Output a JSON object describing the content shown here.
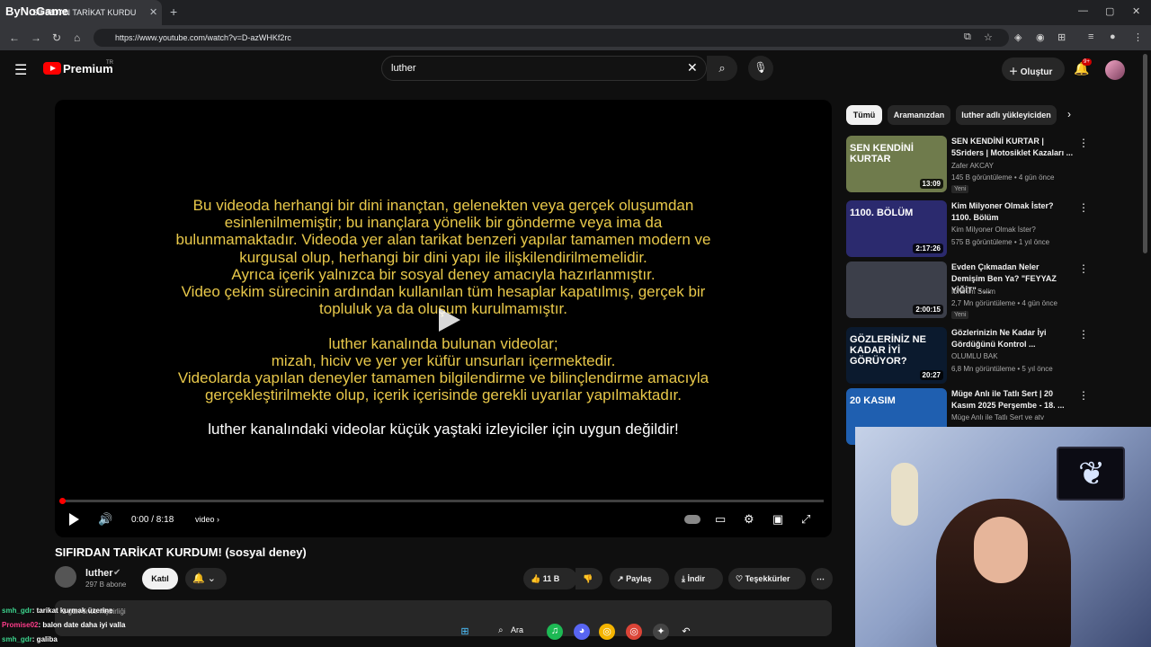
{
  "browser": {
    "tab_title": "SIFIRDAN TARİKAT KURDU",
    "tab_overlay_logo": "ByNoGame",
    "url": "https://www.youtube.com/watch?v=D-azWHKf2rc"
  },
  "youtube_header": {
    "logo_text": "Premium",
    "country": "TR",
    "search_value": "luther",
    "create_label": "Oluştur",
    "notification_count": "9+"
  },
  "player": {
    "disclaimer_lines": [
      "Bu videoda herhangi bir dini inançtan, gelenekten veya gerçek oluşumdan",
      "esinlenilmemiştir; bu inançlara yönelik bir gönderme veya ima da",
      "bulunmamaktadır. Videoda yer alan tarikat benzeri yapılar tamamen modern ve",
      "kurgusal olup, herhangi bir dini yapı ile ilişkilendirilmemelidir.",
      "Ayrıca içerik yalnızca bir sosyal deney amacıyla hazırlanmıştır.",
      "Video çekim sürecinin ardından kullanılan tüm hesaplar kapatılmış, gerçek bir",
      "topluluk ya da oluşum kurulmamıştır.",
      "",
      "luther kanalında bulunan videolar;",
      "mizah, hiciv ve yer yer küfür unsurları içermektedir.",
      "Videolarda yapılan deneyler tamamen bilgilendirme ve bilinçlendirme amacıyla",
      "gerçekleştirilmekte olup, içerik içerisinde gerekli uyarılar yapılmaktadır."
    ],
    "warning_line": "luther kanalındaki videolar küçük yaştaki izleyiciler için uygun değildir!",
    "time": "0:00 / 8:18",
    "chapter": "video",
    "progress_fraction": 0.0
  },
  "video": {
    "title": "SIFIRDAN TARİKAT KURDUM! (sosyal deney)",
    "channel_name": "luther",
    "subscribers": "297 B abone",
    "join_label": "Katıl",
    "likes": "11 B",
    "share_label": "Paylaş",
    "download_label": "İndir",
    "thanks_label": "Teşekkürler",
    "description_meta": "1 gün önce  #işbirliği"
  },
  "sidebar": {
    "chips": [
      "Tümü",
      "Aramanızdan",
      "luther adlı yükleyiciden"
    ],
    "videos": [
      {
        "title": "SEN KENDİNİ KURTAR | 5Sriders | Motosiklet Kazaları ...",
        "channel": "Zafer AKCAY",
        "meta": "145 B görüntüleme • 4 gün önce",
        "badge": "Yeni",
        "duration": "13:09",
        "thumb_text": "SEN KENDİNİ KURTAR",
        "thumb_color": "#6f7b4c"
      },
      {
        "title": "Kim Milyoner Olmak İster? 1100. Bölüm",
        "channel": "Kim Milyoner Olmak İster?",
        "meta": "575 B görüntüleme • 1 yıl önce",
        "badge": "",
        "duration": "2:17:26",
        "thumb_text": "1100. BÖLÜM",
        "thumb_color": "#2b2a6e"
      },
      {
        "title": "Evden Çıkmadan Neler Demişim Ben Ya? \"FEYYAZ YİĞİT\" - ...",
        "channel": "İbrahim Selim",
        "meta": "2,7 Mn görüntüleme • 4 gün önce",
        "badge": "Yeni",
        "duration": "2:00:15",
        "thumb_text": "",
        "thumb_color": "#3c3f4a"
      },
      {
        "title": "Gözlerinizin Ne Kadar İyi Gördüğünü Kontrol ...",
        "channel": "OLUMLU BAK",
        "meta": "6,8 Mn görüntüleme • 5 yıl önce",
        "badge": "",
        "duration": "20:27",
        "thumb_text": "GÖZLERİNİZ NE KADAR İYİ GÖRÜYOR?",
        "thumb_color": "#0b1a2e"
      },
      {
        "title": "Müge Anlı ile Tatlı Sert | 20 Kasım 2025 Perşembe - 18. ...",
        "channel": "Müge Anlı ile Tatlı Sert ve atv",
        "meta": "",
        "badge": "",
        "duration": "",
        "thumb_text": "20 KASIM",
        "thumb_color": "#1f5fb0"
      }
    ]
  },
  "chat": [
    {
      "user": "smh_gdr",
      "text": ": tarikat kurmak üzerine"
    },
    {
      "user": "Promise02",
      "text": ": balon date daha iyi valla"
    },
    {
      "user": "smh_gdr",
      "text": ": galiba"
    }
  ],
  "taskbar": {
    "search_label": "Ara"
  },
  "colors": {
    "youtube_red": "#ff0000",
    "disclaimer_yellow": "#e8c84a",
    "background": "#0f0f0f"
  }
}
